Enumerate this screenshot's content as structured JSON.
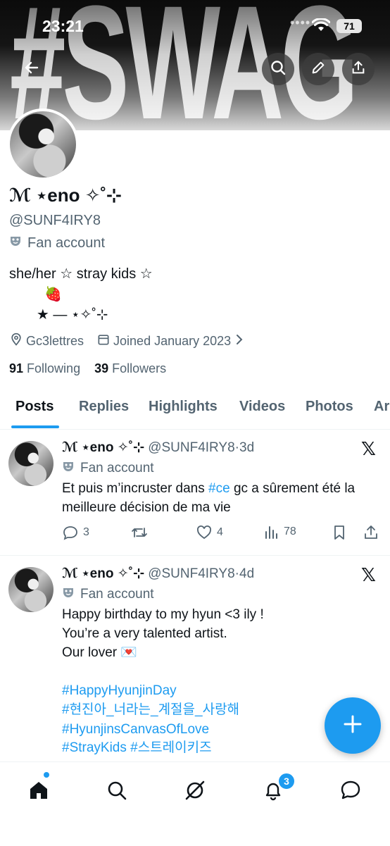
{
  "status_bar": {
    "time": "23:21",
    "battery": "71"
  },
  "banner": {
    "text": "#SWAG"
  },
  "profile": {
    "name": "ℳ ⋆eno ✧˚⊹",
    "handle": "@SUNF4IRY8",
    "category": "Fan account",
    "bio": "she/her ☆ stray kids ☆\n         🍓\n       ★ — ⋆✧˚⊹",
    "location": "Gc3lettres",
    "joined": "Joined January 2023",
    "following_count": "91",
    "following_label": "Following",
    "followers_count": "39",
    "followers_label": "Followers"
  },
  "tabs": [
    "Posts",
    "Replies",
    "Highlights",
    "Videos",
    "Photos",
    "Ar"
  ],
  "posts": [
    {
      "name": "ℳ ⋆eno ✧˚⊹",
      "handle": "@SUNF4IRY8",
      "sep": "·",
      "time": "3d",
      "category": "Fan account",
      "text_before": "Et puis m’incruster dans ",
      "hashtag": "#ce",
      "text_after": " gc a sûrement été la meilleure décision de ma vie",
      "replies": "3",
      "likes": "4",
      "views": "78"
    },
    {
      "name": "ℳ ⋆eno ✧˚⊹",
      "handle": "@SUNF4IRY8",
      "sep": "·",
      "time": "4d",
      "category": "Fan account",
      "text": "Happy birthday to my hyun <3 ily !\nYou’re a very talented artist.\nOur lover 💌",
      "hashtags": [
        "#HappyHyunjinDay",
        "#현진아_너라는_계절을_사랑해",
        "#HyunjinsCanvasOfLove",
        "#StrayKids #스트레이키즈"
      ]
    }
  ],
  "nav": {
    "notifications_badge": "3"
  },
  "icons": [
    "back-arrow-icon",
    "search-icon",
    "edit-icon",
    "share-icon",
    "location-icon",
    "calendar-icon",
    "chevron-right-icon",
    "mask-icon",
    "x-logo-icon",
    "reply-icon",
    "repost-icon",
    "like-icon",
    "views-icon",
    "bookmark-icon",
    "plus-icon",
    "home-icon",
    "grok-icon",
    "bell-icon",
    "messages-icon"
  ],
  "colors": {
    "accent": "#1d9bf0",
    "text": "#0f1419",
    "secondary": "#536471"
  }
}
